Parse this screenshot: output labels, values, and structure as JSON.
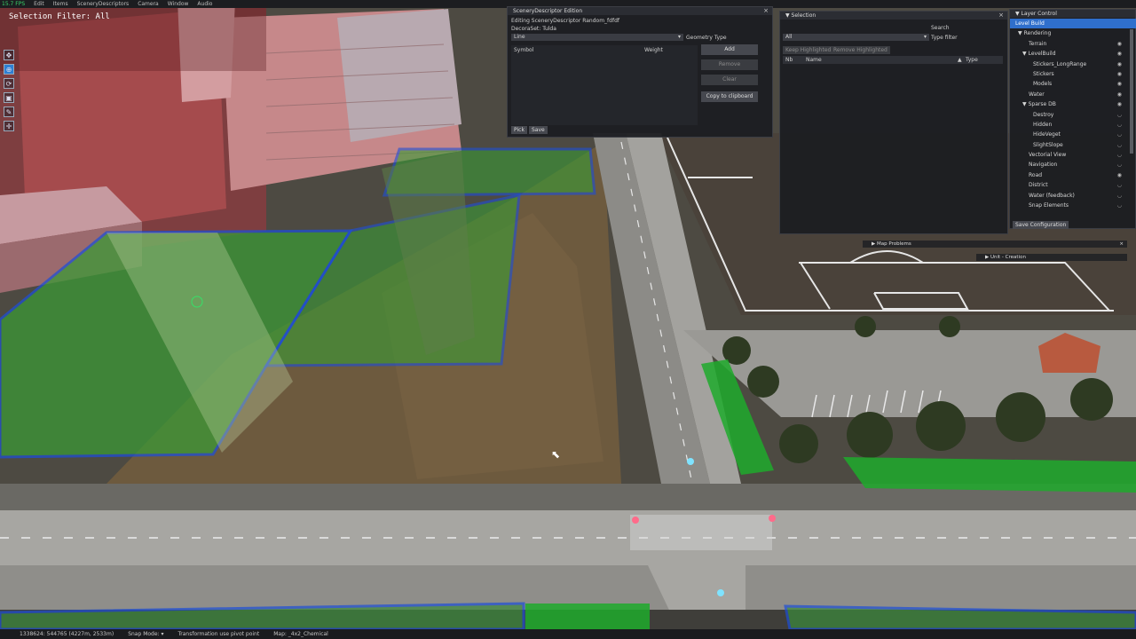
{
  "topbar": {
    "fps": "15.7 FPS",
    "menus": [
      "Edit",
      "Items",
      "SceneryDescriptors",
      "Camera",
      "Window",
      "Audio"
    ]
  },
  "overlay": {
    "selection_filter": "Selection Filter: All"
  },
  "scenery_panel": {
    "title": "SceneryDescriptor Edition",
    "editing": "Editing SceneryDescriptor Random_fdfdf",
    "decoset": "DecoraSet: Tulda",
    "geometry_value": "Line",
    "geometry_label": "Geometry Type",
    "col_symbol": "Symbol",
    "col_weight": "Weight",
    "btn_add": "Add",
    "btn_remove": "Remove",
    "btn_clear": "Clear",
    "btn_copy": "Copy to clipboard",
    "btn_pick": "Pick",
    "btn_save": "Save"
  },
  "selection_panel": {
    "title": "Selection",
    "search_label": "Search",
    "filter_value": "All",
    "type_filter_label": "Type filter",
    "btn_keep": "Keep Highlighted",
    "btn_remove": "Remove Highlighted",
    "col_nb": "Nb",
    "col_name": "Name",
    "col_type": "Type"
  },
  "layer_panel": {
    "title": "Layer Control",
    "items": [
      {
        "label": "Level Build",
        "indent": 0,
        "arrow": "",
        "eye": "",
        "selected": true
      },
      {
        "label": "Rendering",
        "indent": 1,
        "arrow": "▼",
        "eye": ""
      },
      {
        "label": "Terrain",
        "indent": 3,
        "arrow": "",
        "eye": "◉"
      },
      {
        "label": "LevelBuild",
        "indent": 2,
        "arrow": "▼",
        "eye": "◉"
      },
      {
        "label": "Stickers_LongRange",
        "indent": 4,
        "arrow": "",
        "eye": "◉"
      },
      {
        "label": "Stickers",
        "indent": 4,
        "arrow": "",
        "eye": "◉"
      },
      {
        "label": "Models",
        "indent": 4,
        "arrow": "",
        "eye": "◉"
      },
      {
        "label": "Water",
        "indent": 3,
        "arrow": "",
        "eye": "◉"
      },
      {
        "label": "Sparse DB",
        "indent": 2,
        "arrow": "▼",
        "eye": "◉"
      },
      {
        "label": "Destroy",
        "indent": 4,
        "arrow": "",
        "eye": "◡"
      },
      {
        "label": "Hidden",
        "indent": 4,
        "arrow": "",
        "eye": "◡"
      },
      {
        "label": "HideVeget",
        "indent": 4,
        "arrow": "",
        "eye": "◡"
      },
      {
        "label": "SlightSlope",
        "indent": 4,
        "arrow": "",
        "eye": "◡"
      },
      {
        "label": "Vectorial View",
        "indent": 3,
        "arrow": "",
        "eye": "◡"
      },
      {
        "label": "Navigation",
        "indent": 3,
        "arrow": "",
        "eye": "◡"
      },
      {
        "label": "Road",
        "indent": 3,
        "arrow": "",
        "eye": "◉"
      },
      {
        "label": "District",
        "indent": 3,
        "arrow": "",
        "eye": "◡"
      },
      {
        "label": "Water (feedback)",
        "indent": 3,
        "arrow": "",
        "eye": "◡"
      },
      {
        "label": "Snap Elements",
        "indent": 3,
        "arrow": "",
        "eye": "◡"
      }
    ],
    "save_config": "Save Configuration"
  },
  "mini_panels": {
    "map_problems": "Map Problems",
    "unit_creation": "Unit - Creation"
  },
  "statusbar": {
    "coords": "1338624: 544765 (4227m, 2533m)",
    "snap": "Snap Mode:",
    "snap_arrow": "▾",
    "transform": "Transformation use pivot point",
    "map": "Map: _4x2_Chemical"
  },
  "colors": {
    "selection_blue": "#1d4fd8",
    "zone_green": "#3c9b3a",
    "accent": "#2f6fcc"
  }
}
